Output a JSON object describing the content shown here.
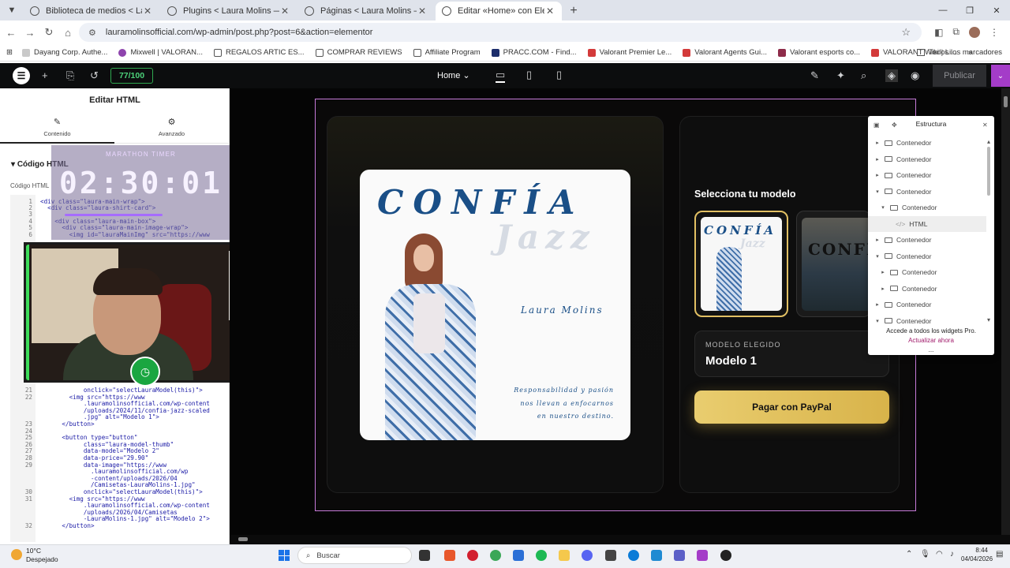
{
  "browser": {
    "tabs": [
      {
        "label": "Biblioteca de medios < Laura M"
      },
      {
        "label": "Plugins < Laura Molins — Wor"
      },
      {
        "label": "Páginas < Laura Molins — Wor"
      },
      {
        "label": "Editar «Home» con Elementor"
      }
    ],
    "url": "lauramolinsofficial.com/wp-admin/post.php?post=6&action=elementor",
    "bookmarks": [
      "Dayang Corp. Authe...",
      "Mixwell | VALORAN...",
      "REGALOS ARTIC ES...",
      "COMPRAR REVIEWS",
      "Affiliate Program",
      "PRACC.COM - Find...",
      "Valorant Premier Le...",
      "Valorant Agents Gui...",
      "Valorant esports co...",
      "VALORANT Wiki | Li..."
    ],
    "bookmarks_overflow": "»",
    "all_bookmarks": "Todos los marcadores"
  },
  "elementor": {
    "score": "77/100",
    "page": "Home",
    "publish": "Publicar",
    "panel_title": "Editar HTML",
    "tab_content": "Contenido",
    "tab_advanced": "Avanzado",
    "section": "Código HTML",
    "field_label": "Código HTML"
  },
  "code_lines": [
    {
      "n": "1",
      "t": "<div class=\"laura-main-wrap\">"
    },
    {
      "n": "2",
      "t": "  <div class=\"laura-shirt-card\">"
    },
    {
      "n": "3",
      "t": ""
    },
    {
      "n": "4",
      "t": "    <div class=\"laura-main-box\">"
    },
    {
      "n": "5",
      "t": "      <div class=\"laura-main-image-wrap\">"
    },
    {
      "n": "6",
      "t": "        <img id=\"lauraMainImg\" src=\"https://www"
    },
    {
      "n": "21",
      "t": "            onclick=\"selectLauraModel(this)\">"
    },
    {
      "n": "22",
      "t": "        <img src=\"https://www"
    },
    {
      "n": "",
      "t": "            .lauramolinsofficial.com/wp-content"
    },
    {
      "n": "",
      "t": "            /uploads/2024/11/confia-jazz-scaled"
    },
    {
      "n": "",
      "t": "            .jpg\" alt=\"Modelo 1\">"
    },
    {
      "n": "23",
      "t": "      </button>"
    },
    {
      "n": "24",
      "t": ""
    },
    {
      "n": "25",
      "t": "      <button type=\"button\""
    },
    {
      "n": "26",
      "t": "            class=\"laura-model-thumb\""
    },
    {
      "n": "27",
      "t": "            data-model=\"Modelo 2\""
    },
    {
      "n": "28",
      "t": "            data-price=\"29.90\""
    },
    {
      "n": "29",
      "t": "            data-image=\"https://www"
    },
    {
      "n": "",
      "t": "              .lauramolinsofficial.com/wp"
    },
    {
      "n": "",
      "t": "              -content/uploads/2026/04"
    },
    {
      "n": "",
      "t": "              /Camisetas-LauraMolins-1.jpg\""
    },
    {
      "n": "30",
      "t": "            onclick=\"selectLauraModel(this)\">"
    },
    {
      "n": "31",
      "t": "        <img src=\"https://www"
    },
    {
      "n": "",
      "t": "            .lauramolinsofficial.com/wp-content"
    },
    {
      "n": "",
      "t": "            /uploads/2026/04/Camisetas"
    },
    {
      "n": "",
      "t": "            -LauraMolins-1.jpg\" alt=\"Modelo 2\">"
    },
    {
      "n": "32",
      "t": "      </button>"
    }
  ],
  "overlay": {
    "timer_label": "MARATHON TIMER",
    "timer_value": "02:30:01"
  },
  "product": {
    "cover_title": "CONFÍA",
    "cover_subtitle": "Jazz",
    "cover_author": "Laura Molins",
    "cover_tagline": [
      "Responsabilidad y pasión",
      "nos llevan a enfocarnos",
      "en nuestro destino."
    ],
    "select_title": "Selecciona tu modelo",
    "thumb1_title": "CONFÍA",
    "thumb1_sub": "Jazz",
    "thumb2_title": "CONFÍA",
    "chosen_label": "MODELO ELEGIDO",
    "chosen_value": "Modelo 1",
    "paypal_label": "Pagar con PayPal"
  },
  "structure": {
    "title": "Estructura",
    "items": [
      {
        "label": "Contenedor",
        "level": 0,
        "expanded": false
      },
      {
        "label": "Contenedor",
        "level": 0,
        "expanded": false
      },
      {
        "label": "Contenedor",
        "level": 0,
        "expanded": false
      },
      {
        "label": "Contenedor",
        "level": 0,
        "expanded": true
      },
      {
        "label": "Contenedor",
        "level": 1,
        "expanded": true
      },
      {
        "label": "HTML",
        "level": 2,
        "expanded": false
      },
      {
        "label": "Contenedor",
        "level": 0,
        "expanded": false
      },
      {
        "label": "Contenedor",
        "level": 0,
        "expanded": true
      },
      {
        "label": "Contenedor",
        "level": 1,
        "expanded": false
      },
      {
        "label": "Contenedor",
        "level": 1,
        "expanded": false
      },
      {
        "label": "Contenedor",
        "level": 0,
        "expanded": false
      },
      {
        "label": "Contenedor",
        "level": 0,
        "expanded": true
      }
    ],
    "pro_text": "Accede a todos los widgets Pro.",
    "pro_link": "Actualizar ahora",
    "more": "..."
  },
  "taskbar": {
    "temp": "10°C",
    "weather": "Despejado",
    "search": "Buscar",
    "time": "8:44",
    "date": "04/04/2026"
  }
}
